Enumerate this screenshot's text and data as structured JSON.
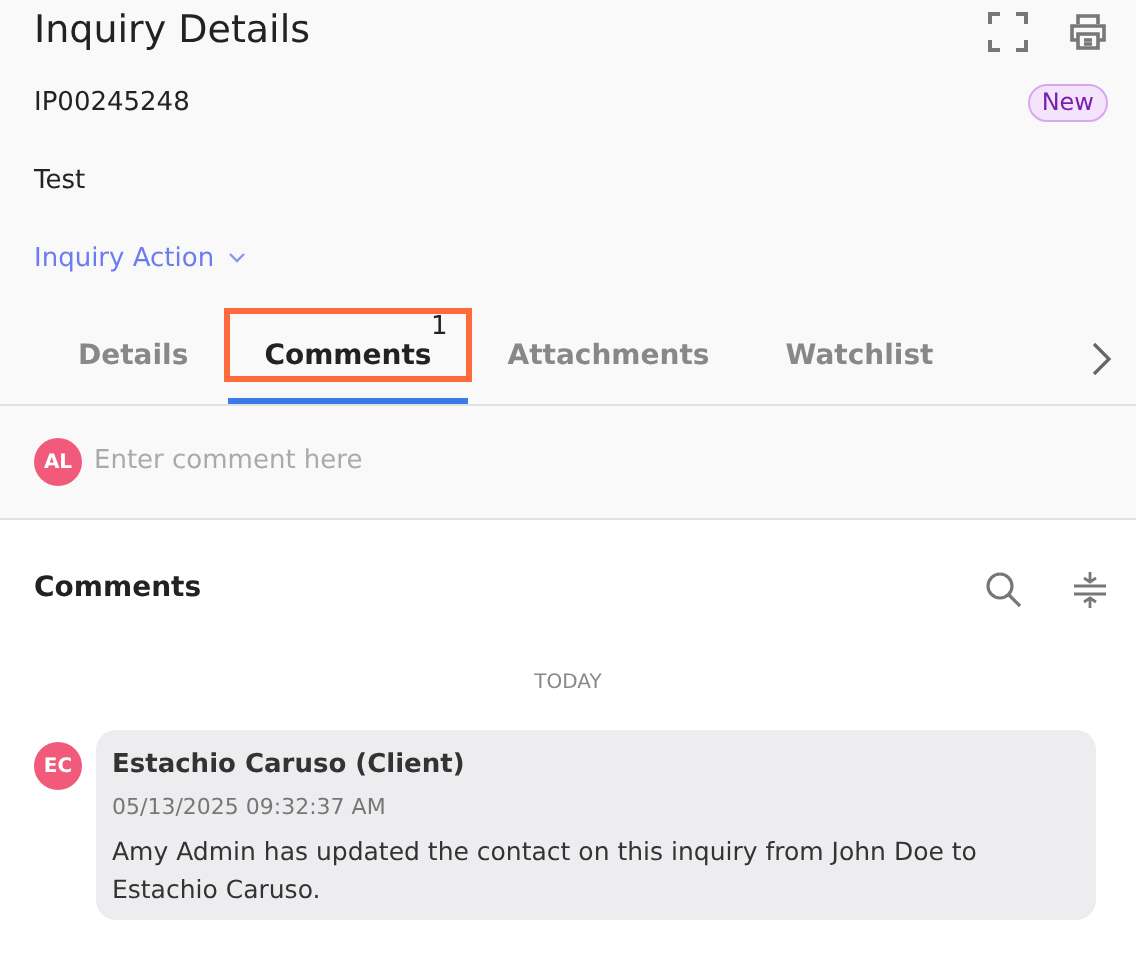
{
  "header": {
    "title": "Inquiry Details",
    "id": "IP00245248",
    "status": "New",
    "subject": "Test",
    "action": "Inquiry Action"
  },
  "tabs": [
    {
      "label": "Details",
      "selected": false,
      "highlighted": false
    },
    {
      "label": "Comments",
      "selected": true,
      "highlighted": true,
      "count": "1"
    },
    {
      "label": "Attachments",
      "selected": false,
      "highlighted": false
    },
    {
      "label": "Watchlist",
      "selected": false,
      "highlighted": false
    }
  ],
  "composer": {
    "avatar": "AL",
    "placeholder": "Enter comment here"
  },
  "comments_section": {
    "title": "Comments",
    "date_divider": "TODAY",
    "comments": [
      {
        "avatar": "EC",
        "author": "Estachio Caruso (Client)",
        "timestamp": "05/13/2025 09:32:37 AM",
        "text": "Amy Admin has updated the contact on this inquiry from John Doe to Estachio Caruso."
      }
    ]
  }
}
